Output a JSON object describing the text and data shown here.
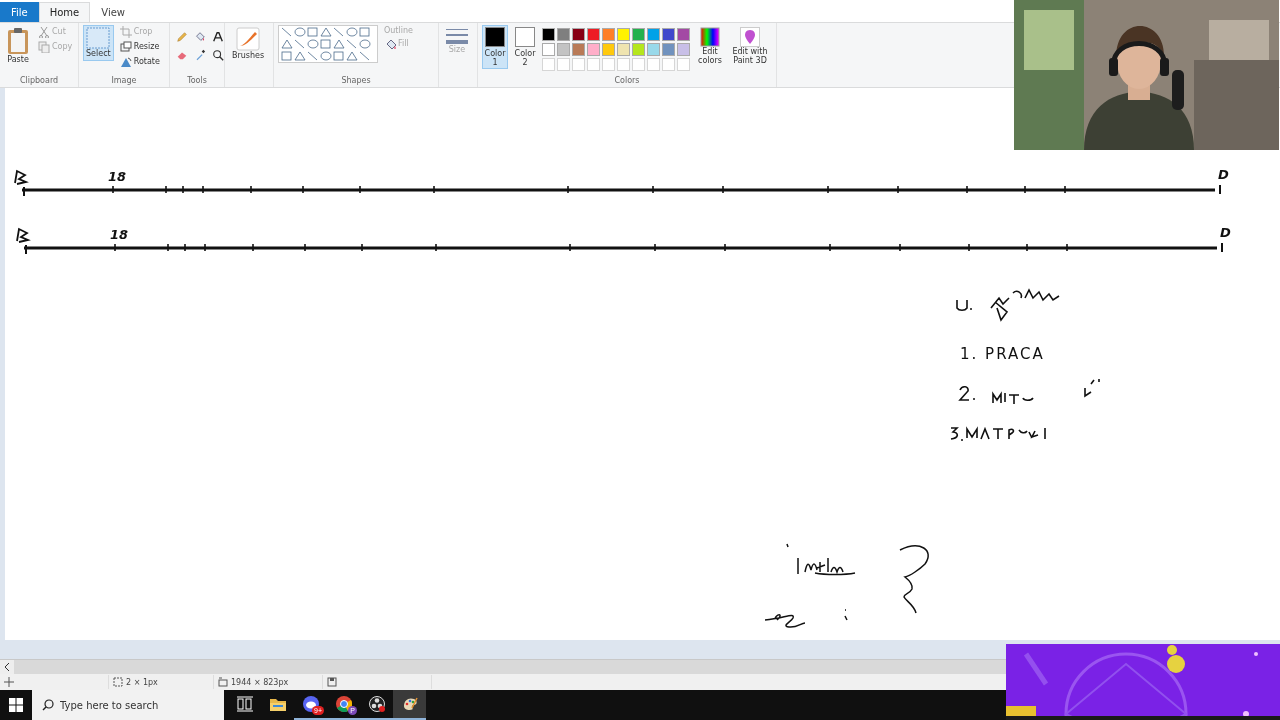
{
  "tabs": [
    {
      "label": "File",
      "kind": "file",
      "selected": false
    },
    {
      "label": "Home",
      "kind": "tab",
      "selected": true
    },
    {
      "label": "View",
      "kind": "tab",
      "selected": false
    }
  ],
  "clipboard": {
    "label": "Clipboard",
    "paste": "Paste",
    "actions": [
      {
        "label": "Cut",
        "kind": "cut",
        "disabled": true
      },
      {
        "label": "Copy",
        "kind": "copy",
        "disabled": true
      }
    ]
  },
  "image": {
    "label": "Image",
    "select": {
      "label": "Select",
      "selected": true
    },
    "actions": [
      {
        "label": "Crop",
        "kind": "crop",
        "disabled": true
      },
      {
        "label": "Resize",
        "kind": "resize",
        "disabled": false
      },
      {
        "label": "Rotate",
        "kind": "rotate",
        "disabled": false
      }
    ]
  },
  "tools": {
    "label": "Tools",
    "items": [
      {
        "kind": "pencil"
      },
      {
        "kind": "fill"
      },
      {
        "kind": "text"
      },
      {
        "kind": "eraser"
      },
      {
        "kind": "picker"
      },
      {
        "kind": "magnifier"
      }
    ]
  },
  "brushes": {
    "label": "Brushes"
  },
  "shapes": {
    "label": "Shapes",
    "outline": {
      "label": "Outline",
      "disabled": true
    },
    "fill": {
      "label": "Fill",
      "disabled": true
    }
  },
  "size": {
    "label": "Size",
    "disabled": true
  },
  "colors": {
    "label": "Colors",
    "color1": {
      "label": "Color 1",
      "color": "#000000",
      "selected": true
    },
    "color2": {
      "label": "Color 2",
      "color": "#ffffff",
      "selected": false
    },
    "palette": [
      {
        "color": "#000000"
      },
      {
        "color": "#7f7f7f"
      },
      {
        "color": "#880015"
      },
      {
        "color": "#ed1c24"
      },
      {
        "color": "#ff7f27"
      },
      {
        "color": "#fff200"
      },
      {
        "color": "#22b14c"
      },
      {
        "color": "#00a2e8"
      },
      {
        "color": "#3f48cc"
      },
      {
        "color": "#a349a4"
      },
      {
        "color": "#ffffff"
      },
      {
        "color": "#c3c3c3"
      },
      {
        "color": "#b97a57"
      },
      {
        "color": "#ffaec9"
      },
      {
        "color": "#ffc90e"
      },
      {
        "color": "#efe4b0"
      },
      {
        "color": "#b5e61d"
      },
      {
        "color": "#99d9ea"
      },
      {
        "color": "#7092be"
      },
      {
        "color": "#c8bfe7"
      }
    ],
    "edit_colors": "Edit colors",
    "paint3d": "Edit with Paint 3D"
  },
  "canvas": {
    "timelines": [
      {
        "tick_label": "18",
        "end_label": "D"
      },
      {
        "tick_label": "18",
        "end_label": "D"
      }
    ],
    "notes": [
      {
        "kind": "scribble"
      },
      {
        "kind": "text",
        "text": "1. PRACA"
      },
      {
        "kind": "scribble"
      },
      {
        "kind": "scribble"
      },
      {
        "kind": "scribble"
      }
    ]
  },
  "status_bar": {
    "selection_size": "2 × 1px",
    "image_size": "1944 × 823px"
  },
  "taskbar": {
    "search": {
      "placeholder": "Type here to search"
    },
    "apps": [
      {
        "kind": "task_view",
        "running": false,
        "active": false
      },
      {
        "kind": "explorer",
        "running": false,
        "active": false
      },
      {
        "kind": "discord",
        "running": true,
        "active": false,
        "badge": "9+"
      },
      {
        "kind": "chrome",
        "running": true,
        "active": false,
        "badge": "P"
      },
      {
        "kind": "obs",
        "running": true,
        "active": false
      },
      {
        "kind": "paint",
        "running": true,
        "active": true
      }
    ]
  }
}
